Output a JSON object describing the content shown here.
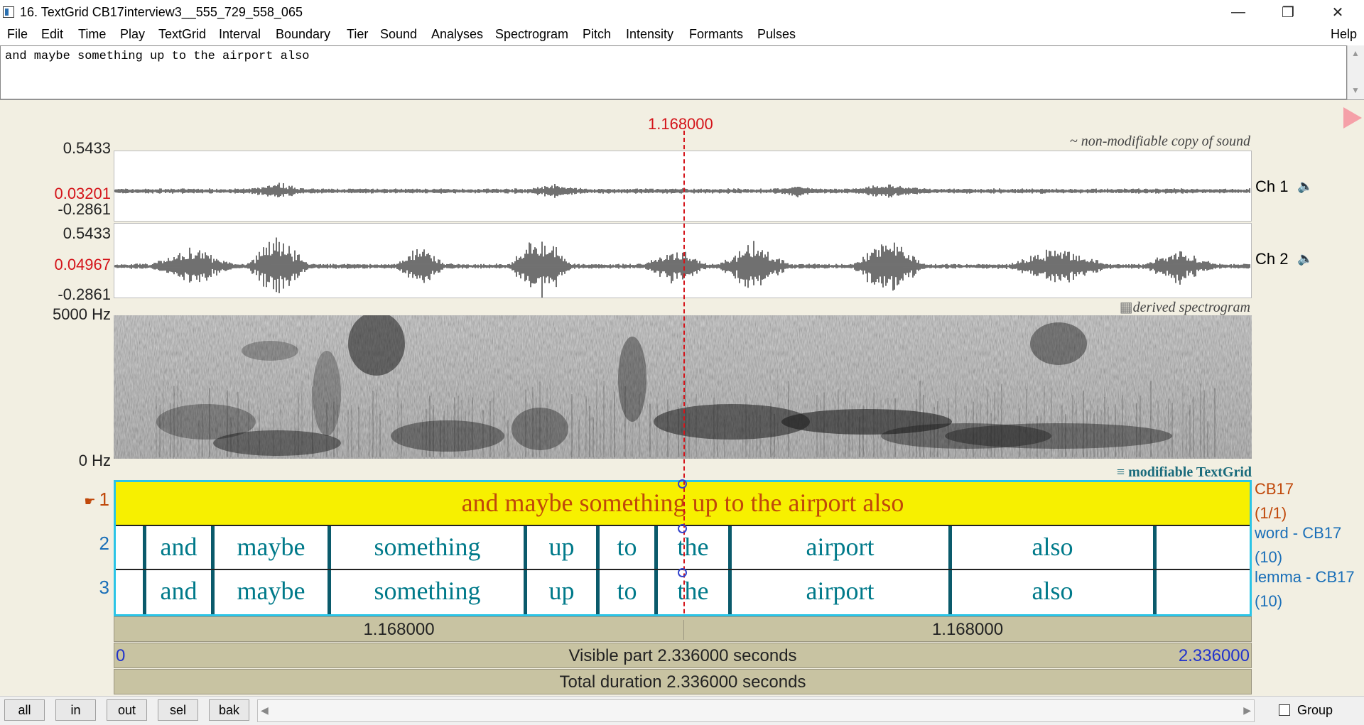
{
  "window": {
    "title": "16. TextGrid CB17interview3__555_729_558_065"
  },
  "menu": [
    "File",
    "Edit",
    "Time",
    "Play",
    "TextGrid",
    "Interval",
    "Boundary",
    "Tier",
    "Sound",
    "Analyses",
    "Spectrogram",
    "Pitch",
    "Intensity",
    "Formants",
    "Pulses"
  ],
  "menu_help": "Help",
  "text_field": {
    "value": "and maybe something up to the airport also"
  },
  "cursor": {
    "time": "1.168000"
  },
  "sound": {
    "note": "~ non-modifiable copy of sound",
    "ch1": {
      "label": "Ch 1",
      "top": "0.5433",
      "current": "0.03201",
      "bottom": "-0.2861"
    },
    "ch2": {
      "label": "Ch 2",
      "top": "0.5433",
      "current": "0.04967",
      "bottom": "-0.2861"
    }
  },
  "spectrogram": {
    "note": "derived spectrogram",
    "top": "5000 Hz",
    "bottom": "0 Hz"
  },
  "textgrid": {
    "note": "modifiable TextGrid",
    "tier1": {
      "num": "1",
      "name": "CB17",
      "count": "(1/1)",
      "text": "and maybe something up to the airport also"
    },
    "tier2": {
      "num": "2",
      "name": "word - CB17",
      "count": "(10)",
      "words": [
        "and",
        "maybe",
        "something",
        "up",
        "to",
        "the",
        "airport",
        "also"
      ]
    },
    "tier3": {
      "num": "3",
      "name": "lemma - CB17",
      "count": "(10)",
      "words": [
        "and",
        "maybe",
        "something",
        "up",
        "to",
        "the",
        "airport",
        "also"
      ]
    }
  },
  "time_bar": {
    "left": "1.168000",
    "right": "1.168000"
  },
  "visible_bar": {
    "start": "0",
    "label": "Visible part 2.336000 seconds",
    "end": "2.336000"
  },
  "total_bar": {
    "label": "Total duration 2.336000 seconds"
  },
  "buttons": {
    "all": "all",
    "in": "in",
    "out": "out",
    "sel": "sel",
    "bak": "bak"
  },
  "group_label": "Group",
  "colors": {
    "cursor": "#d4141a",
    "tier_highlight": "#f7f000",
    "tier_border": "#2bc4e6",
    "bar": "#c8c3a2"
  }
}
